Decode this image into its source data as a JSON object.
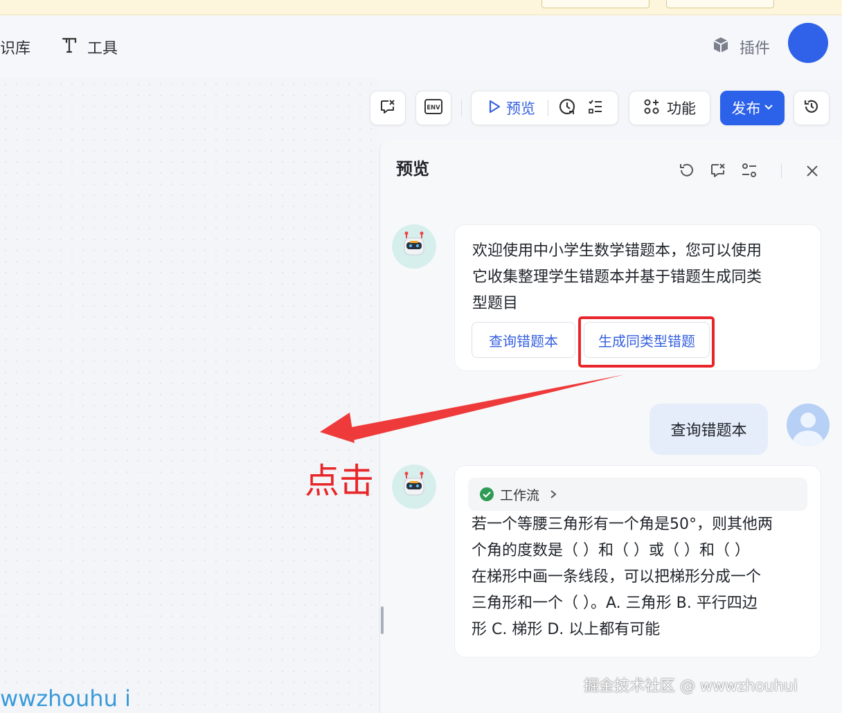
{
  "header": {
    "item_kb": "识库",
    "item_tools": "工具",
    "item_plugins": "插件"
  },
  "toolbar": {
    "preview_label": "预览",
    "functions_label": "功能",
    "publish_label": "发布"
  },
  "panel": {
    "title": "预览",
    "welcome_message": "欢迎使用中小学生数学错题本，您可以使用它收集整理学生错题本并基于错题生成同类型题目",
    "welcome_lines": [
      "欢迎使用中小学生数学错题本，您可以使用",
      "它收集整理学生错题本并基于错题生成同类",
      "型题目"
    ],
    "suggestions": [
      "查询错题本",
      "生成同类型错题"
    ],
    "user_message": "查询错题本",
    "workflow_label": "工作流",
    "answer_lines": [
      "若一个等腰三角形有一个角是50°，则其他两",
      "个角的度数是（ ）和（ ）或（ ）和（ ）",
      "在梯形中画一条线段，可以把梯形分成一个",
      "三角形和一个（ ）。A. 三角形 B. 平行四边",
      "形 C. 梯形 D. 以上都有可能"
    ]
  },
  "annotation": {
    "label": "点击",
    "color": "#e8262a"
  },
  "watermarks": {
    "right": "掘金技术社区 @ wwwzhouhui",
    "left": "wwzhouhu i"
  },
  "colors": {
    "accent": "#2c61ea",
    "bot_avatar_bg": "#d6efed",
    "user_bubble": "#e5ecfa"
  }
}
